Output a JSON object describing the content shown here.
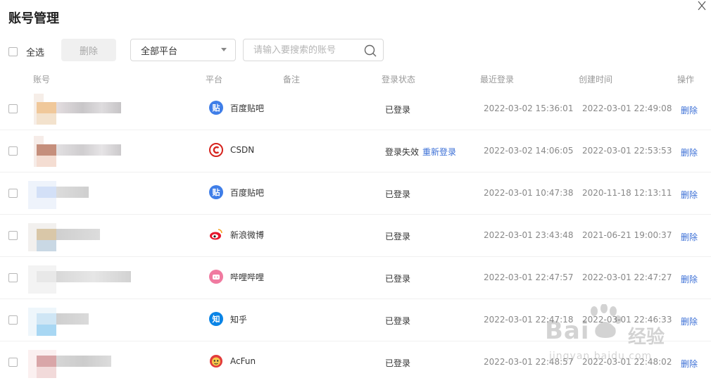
{
  "dialog": {
    "title": "账号管理"
  },
  "toolbar": {
    "select_all_label": "全选",
    "delete_label": "删除",
    "platform_filter": "全部平台",
    "search_placeholder": "请输入要搜索的账号"
  },
  "columns": [
    "账号",
    "平台",
    "备注",
    "登录状态",
    "最近登录",
    "创建时间",
    "操作"
  ],
  "rows": [
    {
      "platform": "百度贴吧",
      "icon": "tieba-icon",
      "status": "已登录",
      "relogin": "",
      "recent": "2022-03-02 15:36:01",
      "created": "2022-03-01 22:49:08",
      "action": "删除"
    },
    {
      "platform": "CSDN",
      "icon": "csdn-icon",
      "status": "登录失效",
      "relogin": "重新登录",
      "recent": "2022-03-02 14:06:05",
      "created": "2022-03-01 22:53:53",
      "action": "删除"
    },
    {
      "platform": "百度贴吧",
      "icon": "tieba-icon",
      "status": "已登录",
      "relogin": "",
      "recent": "2022-03-01 10:47:38",
      "created": "2020-11-18 12:13:11",
      "action": "删除"
    },
    {
      "platform": "新浪微博",
      "icon": "weibo-icon",
      "status": "已登录",
      "relogin": "",
      "recent": "2022-03-01 23:43:48",
      "created": "2021-06-21 19:00:37",
      "action": "删除"
    },
    {
      "platform": "哔哩哔哩",
      "icon": "bilibili-icon",
      "status": "已登录",
      "relogin": "",
      "recent": "2022-03-01 22:47:57",
      "created": "2022-03-01 22:47:27",
      "action": "删除"
    },
    {
      "platform": "知乎",
      "icon": "zhihu-icon",
      "status": "已登录",
      "relogin": "",
      "recent": "2022-03-01 22:47:18",
      "created": "2022-03-01 22:46:33",
      "action": "删除"
    },
    {
      "platform": "AcFun",
      "icon": "acfun-icon",
      "status": "已登录",
      "relogin": "",
      "recent": "2022-03-01 22:48:57",
      "created": "2022-03-01 22:48:02",
      "action": "删除"
    }
  ],
  "icon_glyphs": {
    "tieba": "贴",
    "zhihu": "知"
  },
  "watermark": {
    "brand": "Bai",
    "suffix": "经验",
    "domain": "jingyan.baidu.com"
  },
  "colors": {
    "accent": "#3b6fd6",
    "tieba": "#3f7ee8",
    "csdn": "#d6231d",
    "weibo": "#e6162d",
    "bilibili": "#f07aa0",
    "zhihu": "#0a84e6",
    "acfun": "#e23b3b"
  }
}
